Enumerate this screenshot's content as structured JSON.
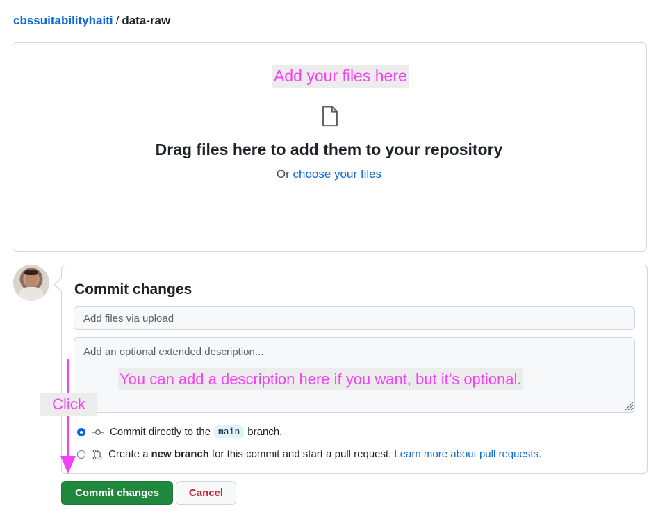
{
  "breadcrumb": {
    "owner": "cbssuitabilityhaiti",
    "separator": "/",
    "repo": "data-raw"
  },
  "dropzone": {
    "annotation": "Add your files here",
    "icon": "file-icon",
    "title": "Drag files here to add them to your repository",
    "or_text": "Or",
    "choose_link": "choose your files"
  },
  "commit": {
    "title": "Commit changes",
    "summary_placeholder": "Add files via upload",
    "description_placeholder": "Add an optional extended description...",
    "description_annotation": "You can add a description here if you want, but it’s optional.",
    "click_annotation": "Click",
    "option_direct": {
      "prefix": "Commit directly to the",
      "branch": "main",
      "suffix": "branch.",
      "icon": "git-commit-icon",
      "selected": true
    },
    "option_new_branch": {
      "prefix": "Create a",
      "bold": "new branch",
      "suffix": "for this commit and start a pull request.",
      "link": "Learn more about pull requests.",
      "icon": "git-pull-request-icon",
      "selected": false
    },
    "commit_button": "Commit changes",
    "cancel_button": "Cancel"
  },
  "colors": {
    "link": "#0969da",
    "annotation": "#f542f5",
    "commit_button": "#1f883d",
    "cancel_text": "#cf222e"
  }
}
